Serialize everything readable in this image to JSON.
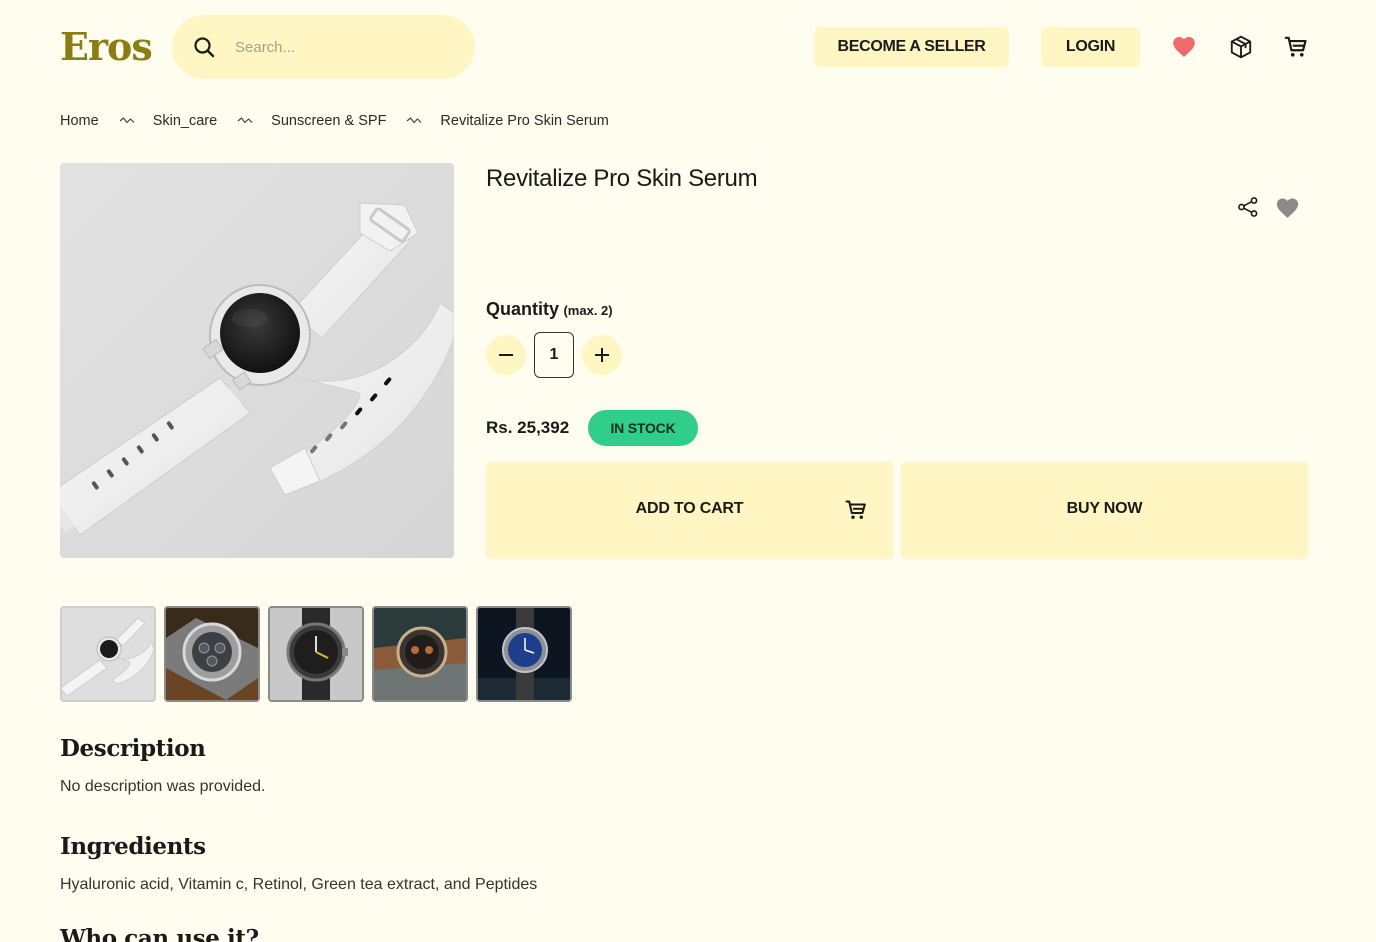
{
  "header": {
    "logo": "Eros",
    "search": {
      "placeholder": "Search...",
      "value": ""
    },
    "become_seller_label": "BECOME A SELLER",
    "login_label": "LOGIN",
    "icons": [
      "heart-icon",
      "package-icon",
      "cart-icon"
    ],
    "accent_color": "#fff6c3",
    "heart_color": "#f06a6a"
  },
  "breadcrumb": {
    "items": [
      "Home",
      "Skin_care",
      "Sunscreen & SPF",
      "Revitalize Pro Skin Serum"
    ]
  },
  "product": {
    "title": "Revitalize Pro Skin Serum",
    "quantity_label": "Quantity",
    "quantity_max": "(max. 2)",
    "quantity_value": "1",
    "price": "Rs. 25,392",
    "stock_status": "IN STOCK",
    "stock_color": "#2fce8a",
    "add_to_cart_label": "ADD TO CART",
    "buy_now_label": "BUY NOW"
  },
  "thumbnails": [
    {
      "name": "white-smartwatch",
      "active": true
    },
    {
      "name": "chronograph-steel-watch",
      "active": false
    },
    {
      "name": "black-leather-watch",
      "active": false
    },
    {
      "name": "chronograph-on-rock-watch",
      "active": false
    },
    {
      "name": "blue-dial-watch",
      "active": false
    }
  ],
  "sections": {
    "description_heading": "Description",
    "description_text": "No description was provided.",
    "ingredients_heading": "Ingredients",
    "ingredients_text": "Hyaluronic acid, Vitamin c, Retinol, Green tea extract, and Peptides",
    "who_heading": "Who can use it?"
  }
}
